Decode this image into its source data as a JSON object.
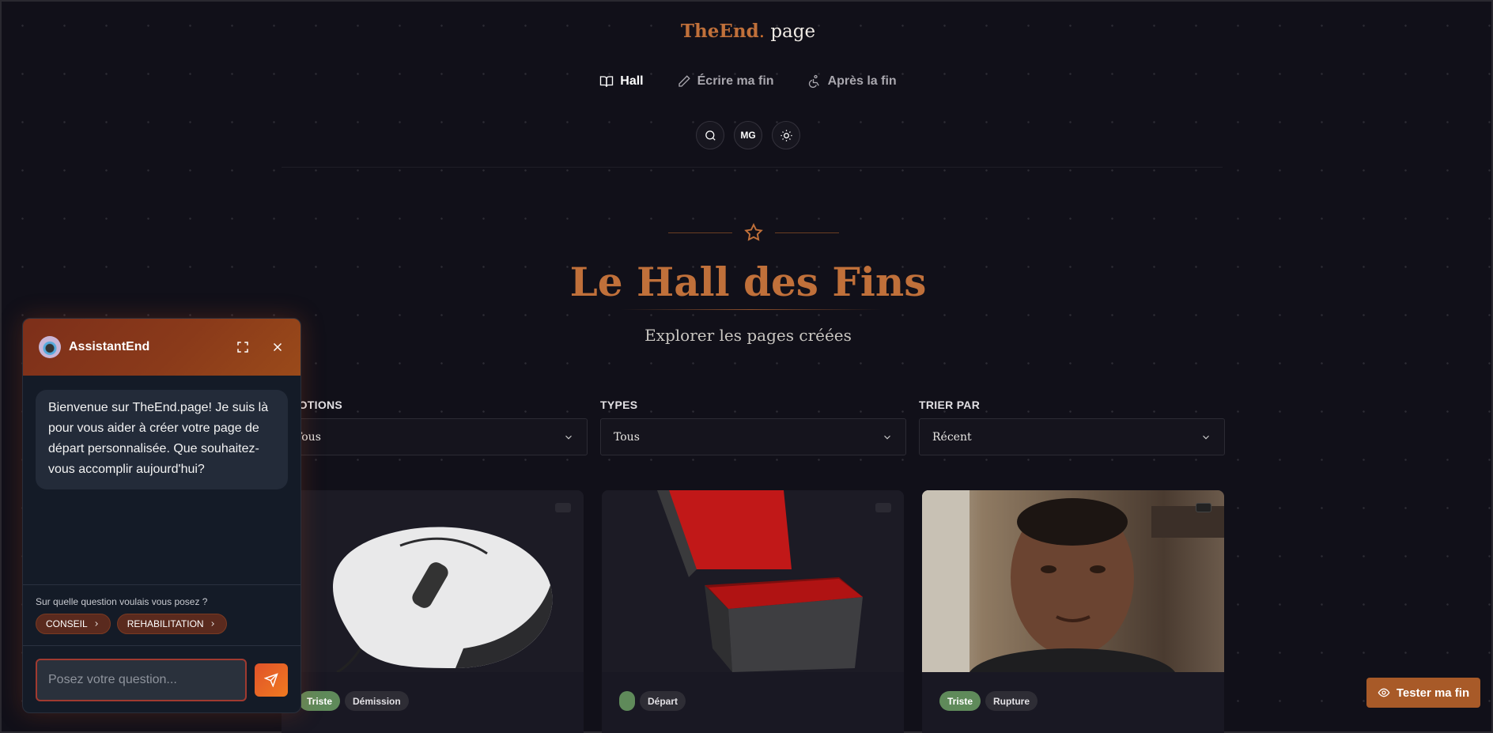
{
  "header": {
    "brand": "TheEnd",
    "dot": ".",
    "suffix": "page",
    "nav": [
      {
        "label": "Hall",
        "icon": "book-icon",
        "active": true
      },
      {
        "label": "Écrire ma fin",
        "icon": "pencil-icon",
        "active": false
      },
      {
        "label": "Après la fin",
        "icon": "wheelchair-icon",
        "active": false
      }
    ],
    "user_initials": "MG"
  },
  "hero": {
    "title": "Le Hall des Fins",
    "subtitle": "Explorer les pages créées"
  },
  "filters": [
    {
      "label": "ÉMOTIONS",
      "value": "Tous"
    },
    {
      "label": "TYPES",
      "value": "Tous"
    },
    {
      "label": "TRIER PAR",
      "value": "Récent"
    }
  ],
  "cards": [
    {
      "image": "computer mouse",
      "tags": [
        "Triste",
        "Démission"
      ]
    },
    {
      "image": "open red box",
      "tags": [
        "",
        "Départ"
      ]
    },
    {
      "image": "portrait selfie",
      "tags": [
        "Triste",
        "Rupture"
      ]
    }
  ],
  "chat": {
    "title": "AssistantEnd",
    "welcome": "Bienvenue sur TheEnd.page! Je suis là pour vous aider à créer votre page de départ personnalisée. Que souhaitez-vous accomplir aujourd'hui?",
    "suggest_question": "Sur quelle question voulais vous posez ?",
    "chips": [
      "CONSEIL",
      "REHABILITATION"
    ],
    "input_placeholder": "Posez votre question..."
  },
  "cta": {
    "label": "Tester ma fin"
  },
  "colors": {
    "accent": "#c0703a",
    "background": "#111019",
    "tag_green": "#5f8a5a"
  }
}
